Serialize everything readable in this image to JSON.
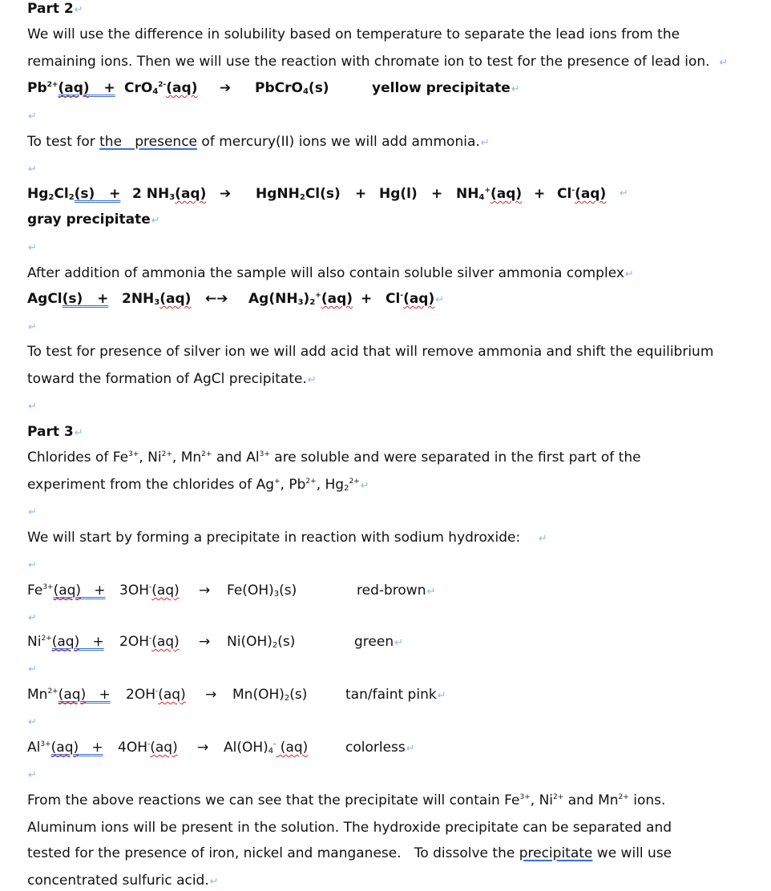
{
  "document": {
    "part2": {
      "heading": "Part 2",
      "intro_line1": "We will use the difference in solubility based on temperature to separate the lead ions from the",
      "intro_line2": "remaining ions. Then we will use the reaction with chromate ion to test for the presence of lead ion.",
      "eq_lead": {
        "reactant1": "Pb",
        "reactant1_sup": "2+",
        "reactant1_state": "(aq)",
        "plus": "+",
        "reactant2": "CrO",
        "reactant2_sub": "4",
        "reactant2_sup": "2-",
        "reactant2_state": "(aq)",
        "arrow": "➔",
        "product": "PbCrO",
        "product_sub": "4",
        "product_state": "(s)",
        "note": "yellow precipitate"
      },
      "mercury_intro_pre": "To test for ",
      "mercury_intro_underlined": "the   presence",
      "mercury_intro_post": " of mercury(II) ions we will add ammonia.",
      "eq_mercury": {
        "r1a": "Hg",
        "r1a_sub": "2",
        "r1b": "Cl",
        "r1b_sub": "2",
        "r1_state": "(s)",
        "plus": "+",
        "r2": "2 NH",
        "r2_sub": "3",
        "r2_state": "(aq)",
        "arrow": "➔",
        "p1a": "HgNH",
        "p1a_sub": "2",
        "p1b": "Cl(s)",
        "p2": "Hg(l)",
        "p3": "NH",
        "p3_sub": "4",
        "p3_sup": "+",
        "p3_state": "(aq)",
        "p4": "Cl",
        "p4_sup": "-",
        "p4_state": "(aq)",
        "note": "gray precipitate"
      },
      "silver_intro": "After addition of ammonia the sample will also contain soluble silver ammonia complex",
      "eq_silver": {
        "r1": "AgCl",
        "r1_state": "(s)",
        "plus": "+",
        "r2": "2NH",
        "r2_sub": "3",
        "r2_state": "(aq)",
        "arrow": "←➔",
        "p1": "Ag(NH",
        "p1_sub1": "3",
        "p1_mid": ")",
        "p1_sub2": "2",
        "p1_sup": "+",
        "p1_state": "(aq)",
        "p2": "Cl",
        "p2_sup": "-",
        "p2_state": "(aq)"
      },
      "silver_test_line1": "To test for presence of silver ion we will add acid that will remove ammonia and shift the equilibrium",
      "silver_test_line2": "toward the formation of AgCl precipitate."
    },
    "part3": {
      "heading": "Part 3",
      "chlorides_line1": {
        "t1": "Chlorides of Fe",
        "s1": "3+",
        "t2": ", Ni",
        "s2": "2+",
        "t3": ", Mn",
        "s3": "2+",
        "t4": " and Al",
        "s4": "3+",
        "t5": " are soluble and were separated in the first part of the"
      },
      "chlorides_line2": {
        "t1": "experiment from the chlorides of Ag",
        "s1": "+",
        "t2": ", Pb",
        "s2": "2+",
        "t3": ", Hg",
        "sub3": "2",
        "s3": "2+"
      },
      "naoh_intro": "We will start by forming a precipitate in reaction with sodium hydroxide:",
      "hydroxide_reactions": [
        {
          "ion": "Fe",
          "ion_sup": "3+",
          "state": "(aq)",
          "plus": "+",
          "oh": "3OH",
          "oh_sup": "-",
          "oh_state": "(aq)",
          "arrow": "→",
          "prod": "Fe(OH)",
          "prod_sub": "3",
          "prod_state": "(s)",
          "prod_sup": "",
          "color": "red-brown"
        },
        {
          "ion": "Ni",
          "ion_sup": "2+",
          "state": "(aq)",
          "plus": "+",
          "oh": "2OH",
          "oh_sup": "-",
          "oh_state": "(aq)",
          "arrow": "→",
          "prod": "Ni(OH)",
          "prod_sub": "2",
          "prod_state": "(s)",
          "prod_sup": "",
          "color": "green"
        },
        {
          "ion": "Mn",
          "ion_sup": "2+",
          "state": "(aq)",
          "plus": "+",
          "oh": "2OH",
          "oh_sup": "-",
          "oh_state": "(aq)",
          "arrow": "→",
          "prod": "Mn(OH)",
          "prod_sub": "2",
          "prod_state": "(s)",
          "prod_sup": "",
          "color": "tan/faint pink"
        },
        {
          "ion": "Al",
          "ion_sup": "3+",
          "state": "(aq)",
          "plus": "+",
          "oh": "4OH",
          "oh_sup": "-",
          "oh_state": "(aq)",
          "arrow": "→",
          "prod": "Al(OH)",
          "prod_sub": "4",
          "prod_state": " (aq)",
          "prod_sup": "-",
          "color": "colorless"
        }
      ],
      "conclusion_line1": {
        "t1": "From the above reactions we can see that the precipitate will contain Fe",
        "s1": "3+",
        "t2": ", Ni",
        "s2": "2+",
        "t3": " and Mn",
        "s3": "2+",
        "t4": " ions."
      },
      "conclusion_line2": "Aluminum ions will be present in the solution. The hydroxide precipitate can be separated and",
      "conclusion_line3_pre": "tested for the presence of iron, nickel and manganese.   To dissolve the ",
      "conclusion_line3_underlined": "precipitate",
      "conclusion_line3_post": " we will use",
      "conclusion_line4": "concentrated sulfuric acid."
    },
    "paragraph_mark": "↵"
  }
}
